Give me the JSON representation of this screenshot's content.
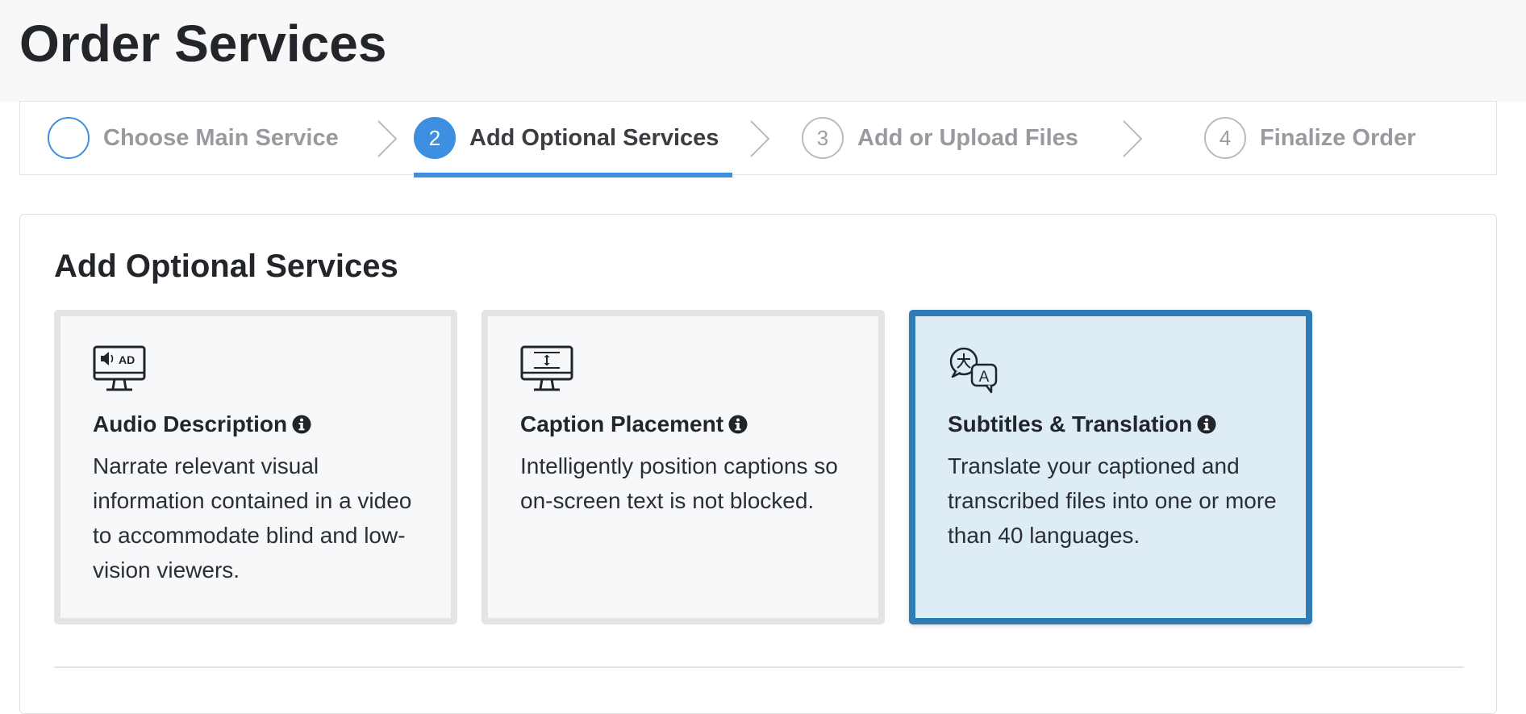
{
  "page": {
    "title": "Order Services"
  },
  "stepper": {
    "steps": [
      {
        "number": "",
        "label": "Choose Main Service",
        "state": "done"
      },
      {
        "number": "2",
        "label": "Add Optional Services",
        "state": "active"
      },
      {
        "number": "3",
        "label": "Add or Upload Files",
        "state": "upcoming"
      },
      {
        "number": "4",
        "label": "Finalize Order",
        "state": "upcoming"
      }
    ]
  },
  "section": {
    "title": "Add Optional Services"
  },
  "options": [
    {
      "icon": "audio-description-monitor-icon",
      "icon_text": "AD",
      "title": "Audio Description",
      "description": "Narrate relevant visual information contained in a video to accommodate blind and low-vision viewers.",
      "selected": false
    },
    {
      "icon": "caption-placement-monitor-icon",
      "title": "Caption Placement",
      "description": "Intelligently position captions so on-screen text is not blocked.",
      "selected": false
    },
    {
      "icon": "translation-bubbles-icon",
      "icon_text": "A",
      "title": "Subtitles & Translation",
      "description": "Translate your captioned and transcribed files into one or more than 40 languages.",
      "selected": true
    }
  ],
  "colors": {
    "accent": "#3d8fe0",
    "selected_border": "#2f7bb4",
    "selected_background": "#deecf5",
    "card_border": "#e3e4e6",
    "card_background": "#f7f8fa",
    "header_background": "#f8f8f8",
    "muted_text": "#979a9e"
  }
}
